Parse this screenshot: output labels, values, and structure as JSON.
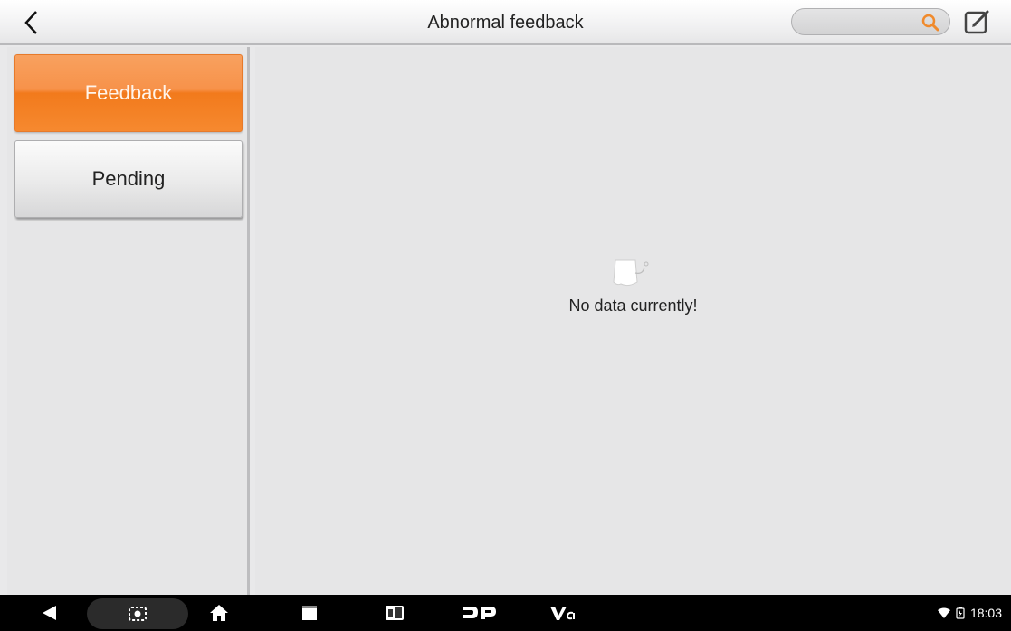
{
  "header": {
    "title": "Abnormal feedback",
    "search_placeholder": "",
    "back_icon": "chevron-left-icon",
    "search_icon": "search-icon",
    "edit_icon": "edit-icon"
  },
  "sidebar": {
    "items": [
      {
        "label": "Feedback",
        "active": true
      },
      {
        "label": "Pending",
        "active": false
      }
    ]
  },
  "main": {
    "empty_message": "No data currently!",
    "empty_icon": "empty-box-icon"
  },
  "navbar": {
    "icons": [
      "back-icon",
      "screenshot-icon",
      "home-icon",
      "recent-apps-icon",
      "vci-switch-icon",
      "dp-icon",
      "vci-icon"
    ],
    "time": "18:03"
  },
  "colors": {
    "accent": "#f7924a",
    "search_icon": "#f08a2c",
    "background": "#e6e6e7"
  }
}
